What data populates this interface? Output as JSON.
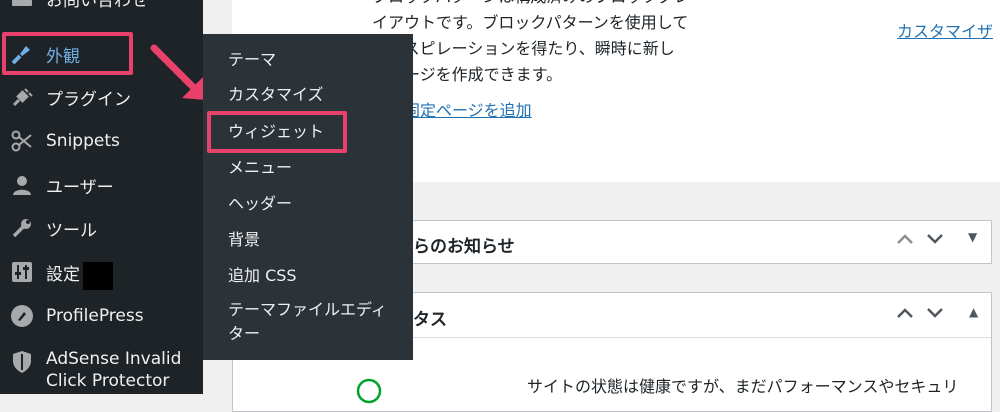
{
  "sidebar": {
    "items": [
      {
        "label": "お問い合わせ",
        "icon": "mail-icon"
      },
      {
        "label": "外観",
        "icon": "appearance-brush-icon"
      },
      {
        "label": "プラグイン",
        "icon": "plugin-icon"
      },
      {
        "label": "Snippets",
        "icon": "scissors-icon"
      },
      {
        "label": "ユーザー",
        "icon": "user-icon"
      },
      {
        "label": "ツール",
        "icon": "wrench-icon"
      },
      {
        "label": "設定",
        "icon": "settings-sliders-icon"
      },
      {
        "label": "ProfilePress",
        "icon": "profilepress-icon"
      },
      {
        "label": "AdSense Invalid Click Protector",
        "label_line1": "AdSense Invalid",
        "label_line2": "Click Protector",
        "icon": "shield-icon"
      }
    ],
    "flyout": [
      {
        "label": "テーマ"
      },
      {
        "label": "カスタマイズ"
      },
      {
        "label": "ウィジェット"
      },
      {
        "label": "メニュー"
      },
      {
        "label": "ヘッダー"
      },
      {
        "label": "背景"
      },
      {
        "label": "追加 CSS"
      },
      {
        "label": "テーマファイルエディター",
        "label_line1": "テーマファイルエディ",
        "label_line2": "ター"
      }
    ]
  },
  "main": {
    "welcome_text": [
      "ブロックパターンは構成済みのブロックグレ",
      "イアウトです。ブロックパターンを使用して",
      "インスピレーションを得たり、瞬時に新し",
      "いページを作成できます。"
    ],
    "add_page_link": "新規固定ページを追加",
    "customizer_link": "カスタマイザ",
    "boxes": [
      {
        "title": "らのお知らせ",
        "toggle": "▼"
      },
      {
        "title": "タス",
        "toggle": "▲"
      }
    ],
    "status_text": "サイトの状態は健康ですが、まだパフォーマンスやセキュリ"
  },
  "colors": {
    "highlight": "#e8416b",
    "sidebar_bg": "#1d2327",
    "flyout_bg": "#2c3338",
    "link": "#2271b1"
  }
}
